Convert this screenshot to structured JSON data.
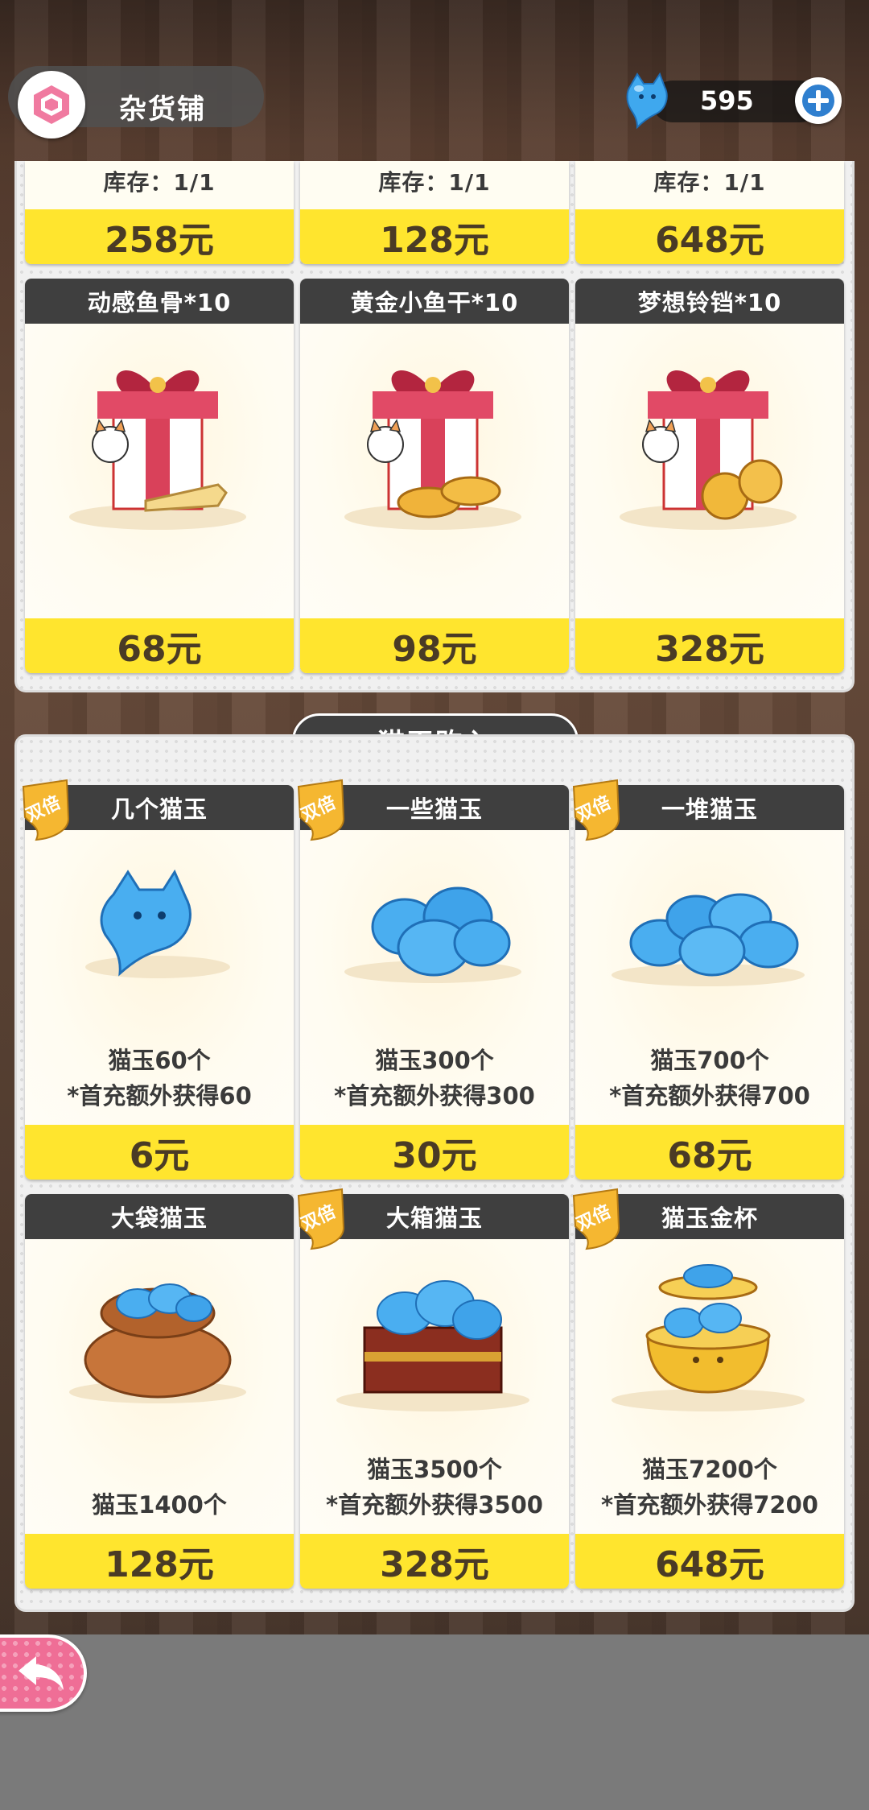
{
  "header": {
    "title": "杂货铺",
    "currency_value": "595",
    "currency_icon": "cat-jade-icon",
    "add_icon": "plus-icon"
  },
  "colors": {
    "price_bg": "#ffe52e",
    "card_header": "#3f3f3f",
    "badge": "#f5b731",
    "back_button": "#ef6e96"
  },
  "top_panel": {
    "partial_row": [
      {
        "stock": "库存：1/1",
        "price": "258元"
      },
      {
        "stock": "库存：1/1",
        "price": "128元"
      },
      {
        "stock": "库存：1/1",
        "price": "648元"
      }
    ],
    "items": [
      {
        "name": "动感鱼骨*10",
        "price": "68元",
        "icon": "gift-box-fishbone-icon"
      },
      {
        "name": "黄金小鱼干*10",
        "price": "98元",
        "icon": "gift-box-golden-fish-icon"
      },
      {
        "name": "梦想铃铛*10",
        "price": "328元",
        "icon": "gift-box-bell-icon"
      }
    ]
  },
  "jade_section": {
    "title": "猫玉购入",
    "double_badge": "双倍",
    "items": [
      {
        "name": "几个猫玉",
        "line1": "猫玉60个",
        "line2": "*首充额外获得60",
        "price": "6元",
        "icon": "single-jade-icon"
      },
      {
        "name": "一些猫玉",
        "line1": "猫玉300个",
        "line2": "*首充额外获得300",
        "price": "30元",
        "icon": "jade-cluster-icon"
      },
      {
        "name": "一堆猫玉",
        "line1": "猫玉700个",
        "line2": "*首充额外获得700",
        "price": "68元",
        "icon": "jade-pile-icon"
      },
      {
        "name": "大袋猫玉",
        "line1": "猫玉1400个",
        "line2": "",
        "price": "128元",
        "icon": "jade-bag-icon"
      },
      {
        "name": "大箱猫玉",
        "line1": "猫玉3500个",
        "line2": "*首充额外获得3500",
        "price": "328元",
        "icon": "jade-chest-icon"
      },
      {
        "name": "猫玉金杯",
        "line1": "猫玉7200个",
        "line2": "*首充额外获得7200",
        "price": "648元",
        "icon": "jade-golden-cup-icon"
      }
    ]
  },
  "footer": {
    "back_icon": "back-arrow-icon"
  }
}
